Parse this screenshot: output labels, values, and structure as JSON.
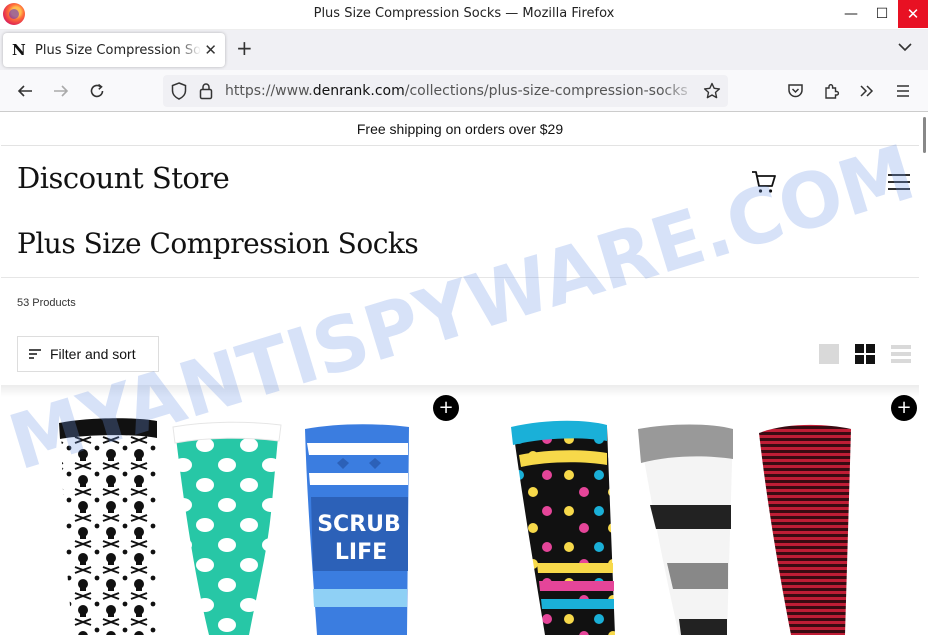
{
  "window": {
    "title": "Plus Size Compression Socks — Mozilla Firefox",
    "minimize_glyph": "—",
    "maximize_glyph": "☐",
    "close_glyph": "✕"
  },
  "tabs": [
    {
      "label": "Plus Size Compression Socks",
      "favicon_letter": "N",
      "close_glyph": "✕"
    }
  ],
  "tabstrip": {
    "new_tab_glyph": "+",
    "list_glyph": "⌄"
  },
  "navbar": {
    "url_prefix": "https://www.",
    "url_domain": "denrank.com",
    "url_path": "/collections/plus-size-compression-socks"
  },
  "page": {
    "announcement": "Free shipping on orders over $29",
    "store_name": "Discount Store",
    "collection_title": "Plus Size Compression Socks",
    "product_count": "53 Products",
    "filter_label": "Filter and sort",
    "quick_add_glyph": "+"
  },
  "watermark": {
    "text": "MYANTISPYWARE.COM",
    "color": "#6f96e6"
  },
  "icons": [
    "firefox-logo-icon",
    "back-arrow-icon",
    "forward-arrow-icon",
    "reload-icon",
    "shield-icon",
    "lock-icon",
    "star-icon",
    "pocket-icon",
    "extensions-icon",
    "overflow-icon",
    "hamburger-menu-icon",
    "cart-icon",
    "filter-icon",
    "grid-view-icon"
  ]
}
